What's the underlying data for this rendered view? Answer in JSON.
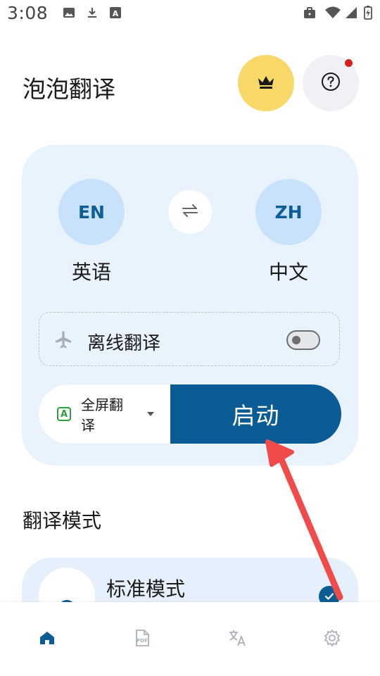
{
  "status_bar": {
    "time": "3:08",
    "left_icons": [
      "image-icon",
      "download-icon",
      "translate-a-icon"
    ],
    "right_icons": [
      "briefcase-icon",
      "wifi-icon",
      "signal-icon",
      "battery-charging-icon"
    ]
  },
  "header": {
    "title": "泡泡翻译",
    "vip_icon": "crown-icon",
    "help_icon": "help-circle-icon"
  },
  "languages": {
    "source_code": "EN",
    "source_name": "英语",
    "target_code": "ZH",
    "target_name": "中文",
    "swap_icon": "swap-arrows-icon"
  },
  "offline": {
    "icon": "airplane-icon",
    "label": "离线翻译",
    "enabled": false
  },
  "action": {
    "mode_icon": "translate-a-icon",
    "mode_label": "全屏翻译",
    "start_label": "启动"
  },
  "section": {
    "title": "翻译模式"
  },
  "modes": [
    {
      "title": "标准模式",
      "icon": "globe-icon",
      "selected": true
    }
  ],
  "bottom_nav": [
    {
      "name": "home",
      "icon": "home-icon",
      "active": true
    },
    {
      "name": "pdf",
      "icon": "pdf-icon",
      "active": false
    },
    {
      "name": "translate",
      "icon": "translate-icon",
      "active": false
    },
    {
      "name": "settings",
      "icon": "gear-icon",
      "active": false
    }
  ],
  "colors": {
    "primary": "#0b5c95",
    "card_bg": "#e9f3fd",
    "lang_circle": "#c8e2fb",
    "vip_bg": "#f8d868",
    "annotation_arrow": "#f04b4b"
  }
}
